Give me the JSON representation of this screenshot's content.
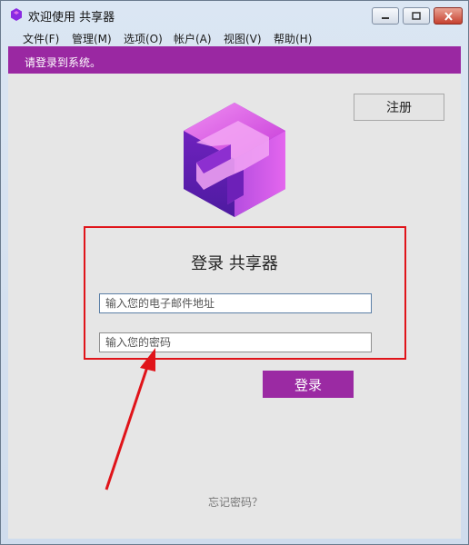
{
  "window": {
    "title": "欢迎使用 共享器"
  },
  "menubar": {
    "items": [
      {
        "label": "文件(F)"
      },
      {
        "label": "管理(M)"
      },
      {
        "label": "选项(O)"
      },
      {
        "label": "帐户(A)"
      },
      {
        "label": "视图(V)"
      },
      {
        "label": "帮助(H)"
      }
    ]
  },
  "banner": {
    "text": "请登录到系统。"
  },
  "header": {
    "register_label": "注册"
  },
  "login": {
    "title": "登录 共享器",
    "email_placeholder": "输入您的电子邮件地址",
    "password_placeholder": "输入您的密码",
    "submit_label": "登录",
    "forgot_label": "忘记密码？"
  },
  "colors": {
    "accent": "#9b2aa3",
    "annotation": "#e0141a"
  }
}
